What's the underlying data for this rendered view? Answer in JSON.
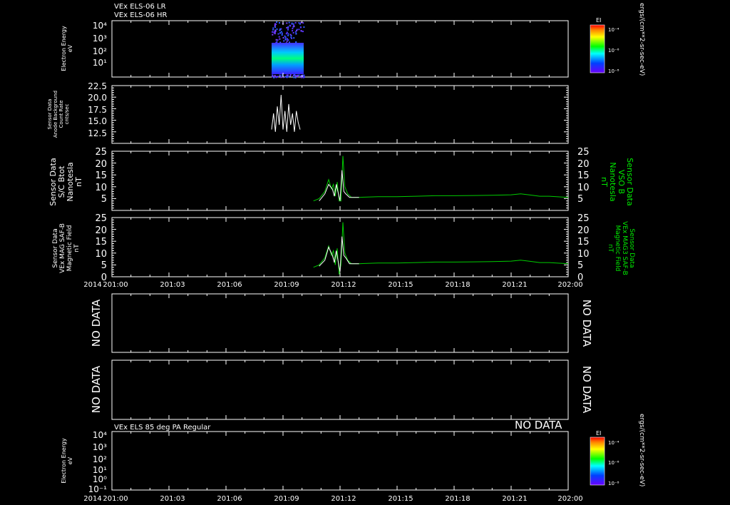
{
  "colors": {
    "bg": "#000000",
    "axis": "#ffffff",
    "trace_white": "#ffffff",
    "trace_green": "#00cc00",
    "label_green": "#00ee00"
  },
  "header": {
    "line1": "VEx ELS-06 LR",
    "line2": "VEx ELS-06 HR"
  },
  "units_right": "ergs/(cm**2-sr-sec-eV)",
  "colorbar": {
    "title": "EI",
    "ticks": [
      "10⁻⁴",
      "10⁻⁶",
      "10⁻⁸"
    ]
  },
  "x_axis": {
    "year_label": "2014",
    "ticks": [
      "201:00",
      "201:03",
      "201:06",
      "201:09",
      "201:12",
      "201:15",
      "201:18",
      "201:21",
      "202:00"
    ]
  },
  "panels": {
    "p1": {
      "ylabel": [
        "Electron Energy",
        "eV"
      ],
      "ticks": [
        "10⁴",
        "10³",
        "10²",
        "10¹"
      ]
    },
    "p2": {
      "ylabel": [
        "Sensor Data",
        "Anode Background",
        "Count Rate",
        "cnts/sec"
      ],
      "ticks": [
        "22.5",
        "20.0",
        "17.5",
        "15.0",
        "12.5"
      ]
    },
    "p3": {
      "ylabel_left": [
        "Sensor Data",
        "S/C Btot",
        "Nanotesla",
        "nT"
      ],
      "ylabel_right": [
        "Sensor Data",
        "VSO B",
        "Nanotesla",
        "nT"
      ],
      "ticks": [
        "25",
        "20",
        "15",
        "10",
        "5"
      ]
    },
    "p4": {
      "ylabel_left": [
        "Sensor Data",
        "VEx MAG SAF-B",
        "Magnetic Field",
        "nT"
      ],
      "ylabel_right": [
        "Sensor Data",
        "VEx MAG3 SAF-B",
        "Magnetic Field",
        "nT"
      ],
      "ticks": [
        "25",
        "20",
        "15",
        "10",
        "5",
        "0"
      ]
    },
    "p5": {
      "no_data": "NO DATA"
    },
    "p6": {
      "no_data": "NO DATA"
    },
    "p7": {
      "header": "VEx ELS 85 deg PA Regular",
      "no_data": "NO DATA",
      "ylabel": [
        "Electron Energy",
        "eV"
      ],
      "ticks": [
        "10⁴",
        "10³",
        "10²",
        "10¹",
        "10⁰",
        "10⁻¹"
      ]
    }
  },
  "chart_data": [
    {
      "type": "heatmap",
      "title": "VEx ELS-06 LR",
      "ylabel": "Electron Energy eV",
      "x_range": [
        "201:00",
        "202:00"
      ],
      "y_scale": "log",
      "ylim": [
        1,
        10000
      ],
      "data_window": [
        "201:08:15",
        "201:09:50"
      ],
      "peak_energy_band_eV": [
        15,
        60
      ]
    },
    {
      "type": "line",
      "ylabel": "Sensor Data Anode Background Count Rate cnts/sec",
      "ylim": [
        10,
        22.5
      ],
      "series": [
        {
          "x": [
            "201:08.4",
            "201:08.5",
            "201:08.6",
            "201:08.7",
            "201:08.8",
            "201:08.9",
            "201:09.0",
            "201:09.1",
            "201:09.2",
            "201:09.3",
            "201:09.4",
            "201:09.5",
            "201:09.6",
            "201:09.7",
            "201:09.8",
            "201:09.9"
          ],
          "values": [
            13,
            16.5,
            12.5,
            18,
            14,
            20.5,
            13,
            17,
            12.5,
            18.5,
            14,
            16.5,
            12.5,
            17,
            14.5,
            13
          ]
        }
      ]
    },
    {
      "type": "line",
      "ylabel": "Sensor Data S/C Btot Nanotesla nT",
      "ylim": [
        0,
        25
      ],
      "series": [
        {
          "color": "white",
          "x": [
            10.9,
            11.2,
            11.4,
            11.6,
            11.7,
            11.8,
            12.0,
            12.1,
            12.2,
            12.3,
            12.5,
            13.0
          ],
          "values": [
            4,
            7,
            11,
            9,
            6,
            11,
            4,
            17,
            8,
            7,
            5.5,
            5.5
          ]
        },
        {
          "name": "VSO B",
          "color": "green",
          "x": [
            10.6,
            10.9,
            11.2,
            11.4,
            11.55,
            11.65,
            11.75,
            11.85,
            11.95,
            12.05,
            12.15,
            12.25,
            12.4,
            12.6,
            13,
            14,
            15,
            16,
            17,
            18,
            19,
            20,
            21,
            21.5,
            22,
            22.5,
            23,
            24
          ],
          "values": [
            4,
            5,
            8,
            13,
            9,
            11,
            6,
            12,
            4,
            4,
            23,
            10,
            7,
            5.5,
            5.5,
            5.8,
            5.8,
            6.0,
            6.2,
            6.2,
            6.3,
            6.4,
            6.6,
            7.0,
            6.5,
            6.0,
            6.0,
            5.5
          ]
        }
      ]
    },
    {
      "type": "line",
      "ylabel": "Sensor Data VEx MAG SAF-B Magnetic Field nT",
      "ylim": [
        0,
        25
      ],
      "series": [
        {
          "color": "white",
          "x": [
            10.9,
            11.2,
            11.4,
            11.6,
            11.7,
            11.8,
            12.0,
            12.1,
            12.2,
            12.3,
            12.5,
            13.0
          ],
          "values": [
            4.5,
            7,
            12.5,
            9,
            6,
            11,
            2,
            17,
            9,
            8,
            5.5,
            5.5
          ]
        },
        {
          "name": "VEx MAG3 SAF-B",
          "color": "green",
          "x": [
            10.6,
            10.9,
            11.2,
            11.4,
            11.55,
            11.65,
            11.75,
            11.85,
            11.95,
            12.05,
            12.15,
            12.25,
            12.4,
            12.6,
            13,
            14,
            15,
            16,
            17,
            18,
            19,
            20,
            21,
            21.5,
            22,
            22.5,
            23,
            24
          ],
          "values": [
            4,
            5,
            8,
            13,
            9,
            11,
            5,
            12,
            1,
            5,
            23,
            10,
            7,
            5.5,
            5.5,
            5.8,
            5.8,
            6.0,
            6.2,
            6.2,
            6.3,
            6.4,
            6.6,
            7.0,
            6.5,
            6.0,
            6.0,
            5.5
          ]
        }
      ]
    }
  ]
}
